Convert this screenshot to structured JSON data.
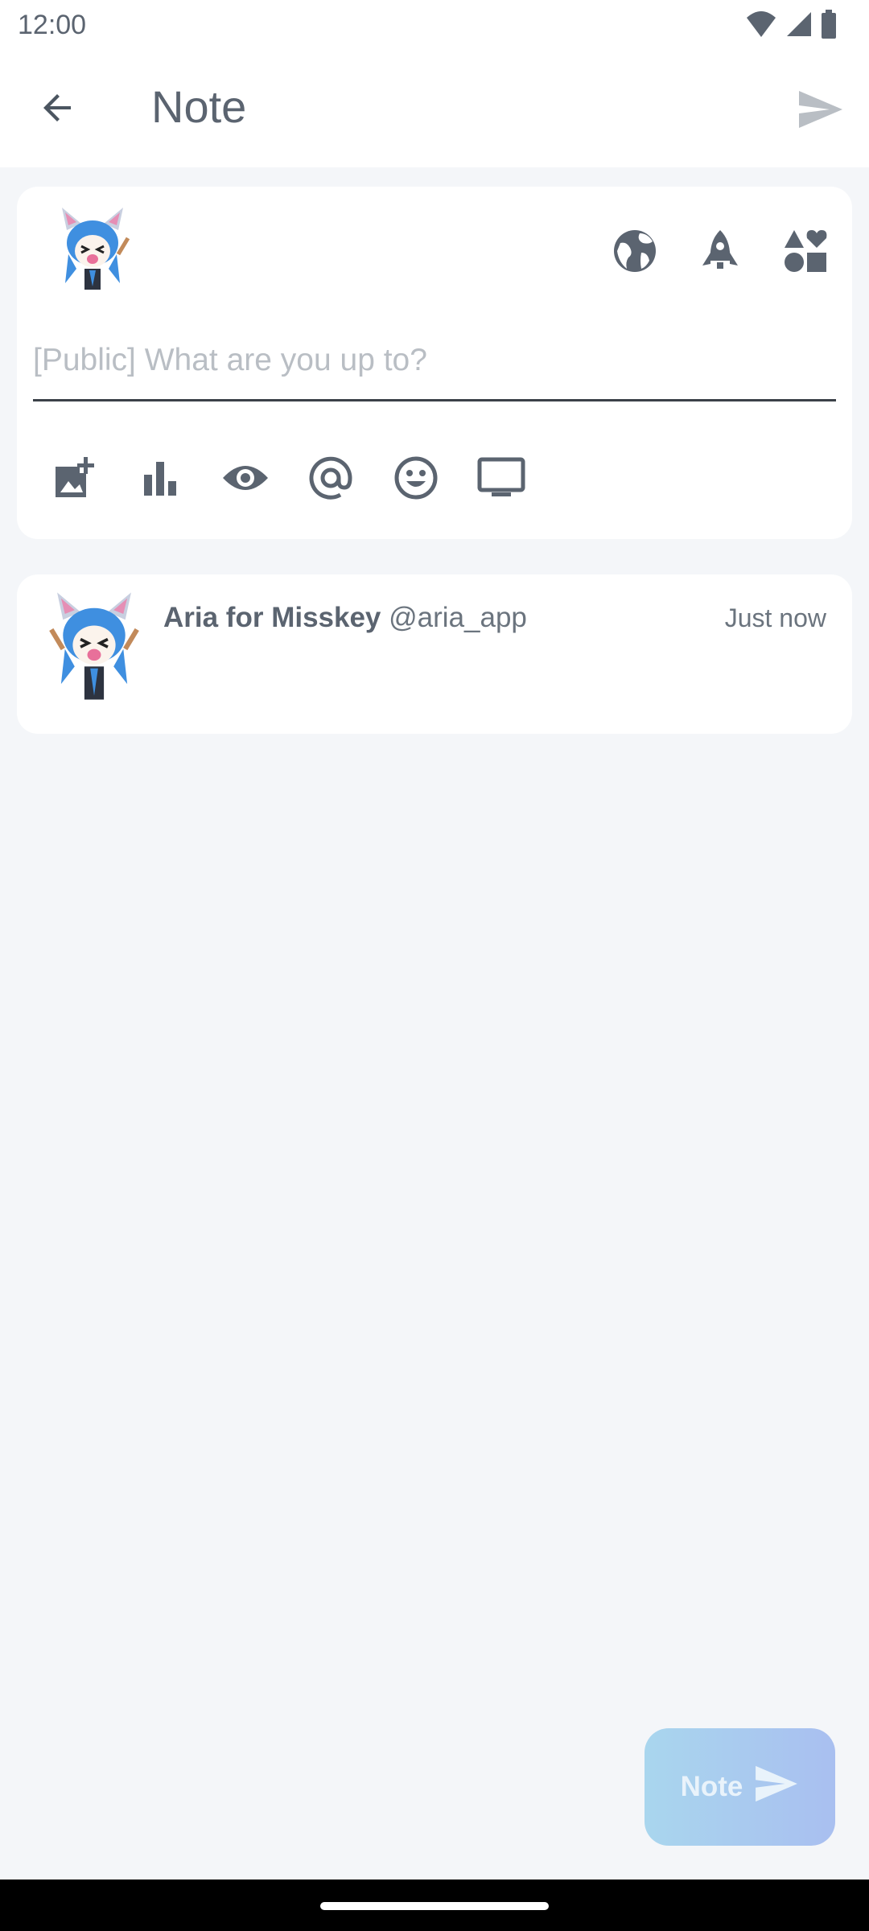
{
  "status_bar": {
    "time": "12:00"
  },
  "app_bar": {
    "title": "Note"
  },
  "compose": {
    "placeholder": "[Public] What are you up to?",
    "value": ""
  },
  "preview_note": {
    "display_name": "Aria for Misskey",
    "handle": "@aria_app",
    "time": "Just now"
  },
  "fab": {
    "label": "Note"
  },
  "colors": {
    "background": "#f4f6f9",
    "card": "#ffffff",
    "icon": "#5b6470",
    "fab_start": "#a9d6ee",
    "fab_end": "#a9bff0"
  },
  "icons": {
    "status": [
      "wifi-icon",
      "signal-icon",
      "battery-icon"
    ],
    "header": [
      "back-arrow-icon",
      "send-icon"
    ],
    "compose_top": [
      "globe-icon",
      "rocket-icon",
      "shapes-icon"
    ],
    "compose_tools": [
      "add-photo-icon",
      "poll-icon",
      "eye-icon",
      "mention-icon",
      "emoji-icon",
      "monitor-icon"
    ]
  }
}
